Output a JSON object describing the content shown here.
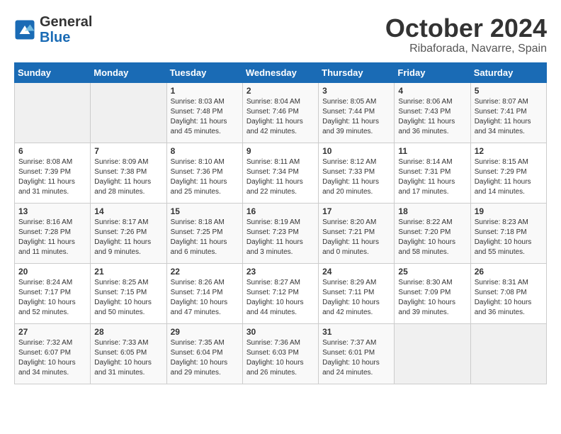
{
  "logo": {
    "line1": "General",
    "line2": "Blue"
  },
  "title": "October 2024",
  "location": "Ribaforada, Navarre, Spain",
  "weekdays": [
    "Sunday",
    "Monday",
    "Tuesday",
    "Wednesday",
    "Thursday",
    "Friday",
    "Saturday"
  ],
  "weeks": [
    [
      {
        "day": "",
        "info": ""
      },
      {
        "day": "",
        "info": ""
      },
      {
        "day": "1",
        "info": "Sunrise: 8:03 AM\nSunset: 7:48 PM\nDaylight: 11 hours and 45 minutes."
      },
      {
        "day": "2",
        "info": "Sunrise: 8:04 AM\nSunset: 7:46 PM\nDaylight: 11 hours and 42 minutes."
      },
      {
        "day": "3",
        "info": "Sunrise: 8:05 AM\nSunset: 7:44 PM\nDaylight: 11 hours and 39 minutes."
      },
      {
        "day": "4",
        "info": "Sunrise: 8:06 AM\nSunset: 7:43 PM\nDaylight: 11 hours and 36 minutes."
      },
      {
        "day": "5",
        "info": "Sunrise: 8:07 AM\nSunset: 7:41 PM\nDaylight: 11 hours and 34 minutes."
      }
    ],
    [
      {
        "day": "6",
        "info": "Sunrise: 8:08 AM\nSunset: 7:39 PM\nDaylight: 11 hours and 31 minutes."
      },
      {
        "day": "7",
        "info": "Sunrise: 8:09 AM\nSunset: 7:38 PM\nDaylight: 11 hours and 28 minutes."
      },
      {
        "day": "8",
        "info": "Sunrise: 8:10 AM\nSunset: 7:36 PM\nDaylight: 11 hours and 25 minutes."
      },
      {
        "day": "9",
        "info": "Sunrise: 8:11 AM\nSunset: 7:34 PM\nDaylight: 11 hours and 22 minutes."
      },
      {
        "day": "10",
        "info": "Sunrise: 8:12 AM\nSunset: 7:33 PM\nDaylight: 11 hours and 20 minutes."
      },
      {
        "day": "11",
        "info": "Sunrise: 8:14 AM\nSunset: 7:31 PM\nDaylight: 11 hours and 17 minutes."
      },
      {
        "day": "12",
        "info": "Sunrise: 8:15 AM\nSunset: 7:29 PM\nDaylight: 11 hours and 14 minutes."
      }
    ],
    [
      {
        "day": "13",
        "info": "Sunrise: 8:16 AM\nSunset: 7:28 PM\nDaylight: 11 hours and 11 minutes."
      },
      {
        "day": "14",
        "info": "Sunrise: 8:17 AM\nSunset: 7:26 PM\nDaylight: 11 hours and 9 minutes."
      },
      {
        "day": "15",
        "info": "Sunrise: 8:18 AM\nSunset: 7:25 PM\nDaylight: 11 hours and 6 minutes."
      },
      {
        "day": "16",
        "info": "Sunrise: 8:19 AM\nSunset: 7:23 PM\nDaylight: 11 hours and 3 minutes."
      },
      {
        "day": "17",
        "info": "Sunrise: 8:20 AM\nSunset: 7:21 PM\nDaylight: 11 hours and 0 minutes."
      },
      {
        "day": "18",
        "info": "Sunrise: 8:22 AM\nSunset: 7:20 PM\nDaylight: 10 hours and 58 minutes."
      },
      {
        "day": "19",
        "info": "Sunrise: 8:23 AM\nSunset: 7:18 PM\nDaylight: 10 hours and 55 minutes."
      }
    ],
    [
      {
        "day": "20",
        "info": "Sunrise: 8:24 AM\nSunset: 7:17 PM\nDaylight: 10 hours and 52 minutes."
      },
      {
        "day": "21",
        "info": "Sunrise: 8:25 AM\nSunset: 7:15 PM\nDaylight: 10 hours and 50 minutes."
      },
      {
        "day": "22",
        "info": "Sunrise: 8:26 AM\nSunset: 7:14 PM\nDaylight: 10 hours and 47 minutes."
      },
      {
        "day": "23",
        "info": "Sunrise: 8:27 AM\nSunset: 7:12 PM\nDaylight: 10 hours and 44 minutes."
      },
      {
        "day": "24",
        "info": "Sunrise: 8:29 AM\nSunset: 7:11 PM\nDaylight: 10 hours and 42 minutes."
      },
      {
        "day": "25",
        "info": "Sunrise: 8:30 AM\nSunset: 7:09 PM\nDaylight: 10 hours and 39 minutes."
      },
      {
        "day": "26",
        "info": "Sunrise: 8:31 AM\nSunset: 7:08 PM\nDaylight: 10 hours and 36 minutes."
      }
    ],
    [
      {
        "day": "27",
        "info": "Sunrise: 7:32 AM\nSunset: 6:07 PM\nDaylight: 10 hours and 34 minutes."
      },
      {
        "day": "28",
        "info": "Sunrise: 7:33 AM\nSunset: 6:05 PM\nDaylight: 10 hours and 31 minutes."
      },
      {
        "day": "29",
        "info": "Sunrise: 7:35 AM\nSunset: 6:04 PM\nDaylight: 10 hours and 29 minutes."
      },
      {
        "day": "30",
        "info": "Sunrise: 7:36 AM\nSunset: 6:03 PM\nDaylight: 10 hours and 26 minutes."
      },
      {
        "day": "31",
        "info": "Sunrise: 7:37 AM\nSunset: 6:01 PM\nDaylight: 10 hours and 24 minutes."
      },
      {
        "day": "",
        "info": ""
      },
      {
        "day": "",
        "info": ""
      }
    ]
  ]
}
